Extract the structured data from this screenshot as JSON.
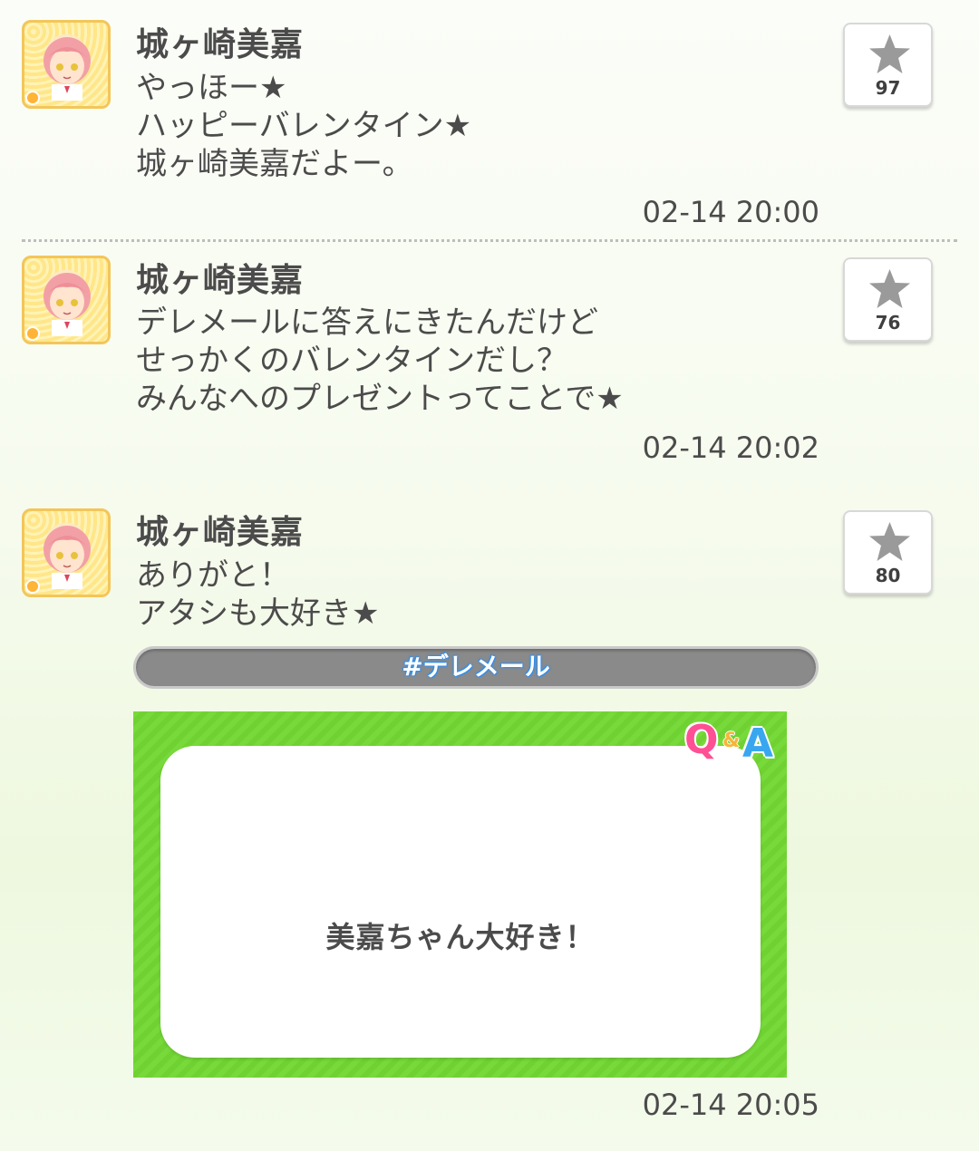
{
  "posts": [
    {
      "author": "城ヶ崎美嘉",
      "lines": [
        "やっほー★",
        "ハッピーバレンタイン★",
        "城ヶ崎美嘉だよー。"
      ],
      "timestamp": "02-14 20:00",
      "likes": "97"
    },
    {
      "author": "城ヶ崎美嘉",
      "lines": [
        "デレメールに答えにきたんだけど",
        "せっかくのバレンタインだし？",
        "みんなへのプレゼントってことで★"
      ],
      "timestamp": "02-14 20:02",
      "likes": "76"
    },
    {
      "author": "城ヶ崎美嘉",
      "lines": [
        "ありがと！",
        "アタシも大好き★"
      ],
      "timestamp": "02-14 20:05",
      "likes": "80",
      "hashtag": "#デレメール",
      "qa_card": {
        "logo": {
          "q": "Q",
          "amp": "&",
          "a": "A"
        },
        "text": "美嘉ちゃん大好き！"
      }
    }
  ],
  "icons": {
    "like": "star-icon",
    "avatar": "character-avatar"
  },
  "colors": {
    "card_green": "#77d93a",
    "hashtag_bg": "#8a8a8a",
    "avatar_border": "#f3c65a",
    "star_gray": "#9a9a9a"
  }
}
